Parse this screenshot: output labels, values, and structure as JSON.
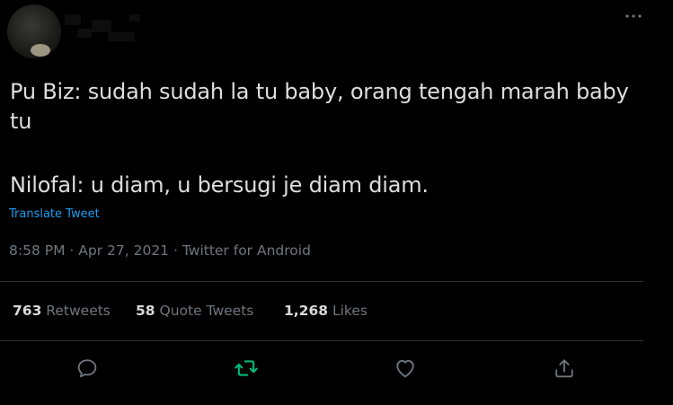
{
  "tweet": {
    "text_lines": [
      "Pu Biz: sudah sudah la tu baby, orang tengah marah baby tu",
      "Nilofal: u diam, u bersugi je diam diam."
    ],
    "translate_label": "Translate Tweet",
    "time": "8:58 PM",
    "date": "Apr 27, 2021",
    "source": "Twitter for Android",
    "separator": "·"
  },
  "stats": {
    "retweets_count": "763",
    "retweets_label": "Retweets",
    "quote_count": "58",
    "quote_label": "Quote Tweets",
    "likes_count": "1,268",
    "likes_label": "Likes"
  },
  "actions": [
    {
      "name": "reply",
      "icon": "speech-bubble-icon",
      "color": "#6e767d"
    },
    {
      "name": "retweet",
      "icon": "retweet-icon",
      "color": "#00ba7c"
    },
    {
      "name": "like",
      "icon": "heart-icon",
      "color": "#6e767d"
    },
    {
      "name": "share",
      "icon": "share-icon",
      "color": "#6e767d"
    }
  ],
  "colors": {
    "background": "#000000",
    "text": "#d9d9d9",
    "secondary": "#6e767d",
    "link": "#1d9bf0",
    "retweet_active": "#00ba7c",
    "divider": "#2f3336"
  }
}
